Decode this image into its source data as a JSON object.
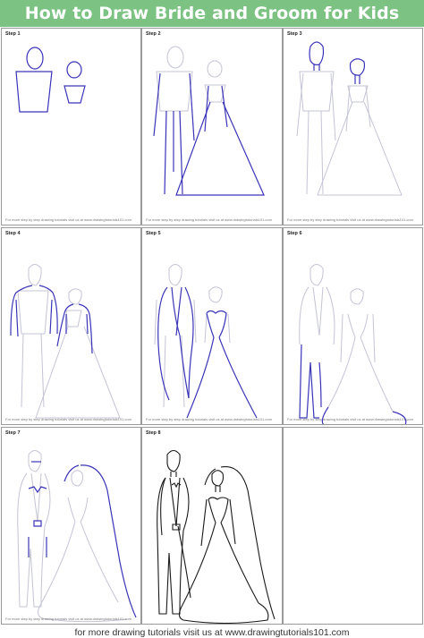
{
  "title": "How to Draw Bride and Groom for Kids",
  "steps": [
    {
      "label": "Step 1",
      "credit": "For more step by step drawing tutorials visit us at www.drawingtutorials101.com"
    },
    {
      "label": "Step 2",
      "credit": "For more step by step drawing tutorials visit us at www.drawingtutorials101.com"
    },
    {
      "label": "Step 3",
      "credit": "For more step by step drawing tutorials visit us at www.drawingtutorials101.com"
    },
    {
      "label": "Step 4",
      "credit": "For more step by step drawing tutorials visit us at www.drawingtutorials101.com"
    },
    {
      "label": "Step 5",
      "credit": "For more step by step drawing tutorials visit us at www.drawingtutorials101.com"
    },
    {
      "label": "Step 6",
      "credit": "For more step by step drawing tutorials visit us at www.drawingtutorials101.com"
    },
    {
      "label": "Step 7",
      "credit": "For more step by step drawing tutorials visit us at www.drawingtutorials101.com"
    },
    {
      "label": "Step 8",
      "credit": ""
    }
  ],
  "footer": "for more drawing tutorials visit us at www.drawingtutorials101.com",
  "colors": {
    "banner": "#7cc383",
    "new_lines": "#3a34b8",
    "guide_lines": "#c4c4d6",
    "final_lines": "#1a1a1a"
  }
}
